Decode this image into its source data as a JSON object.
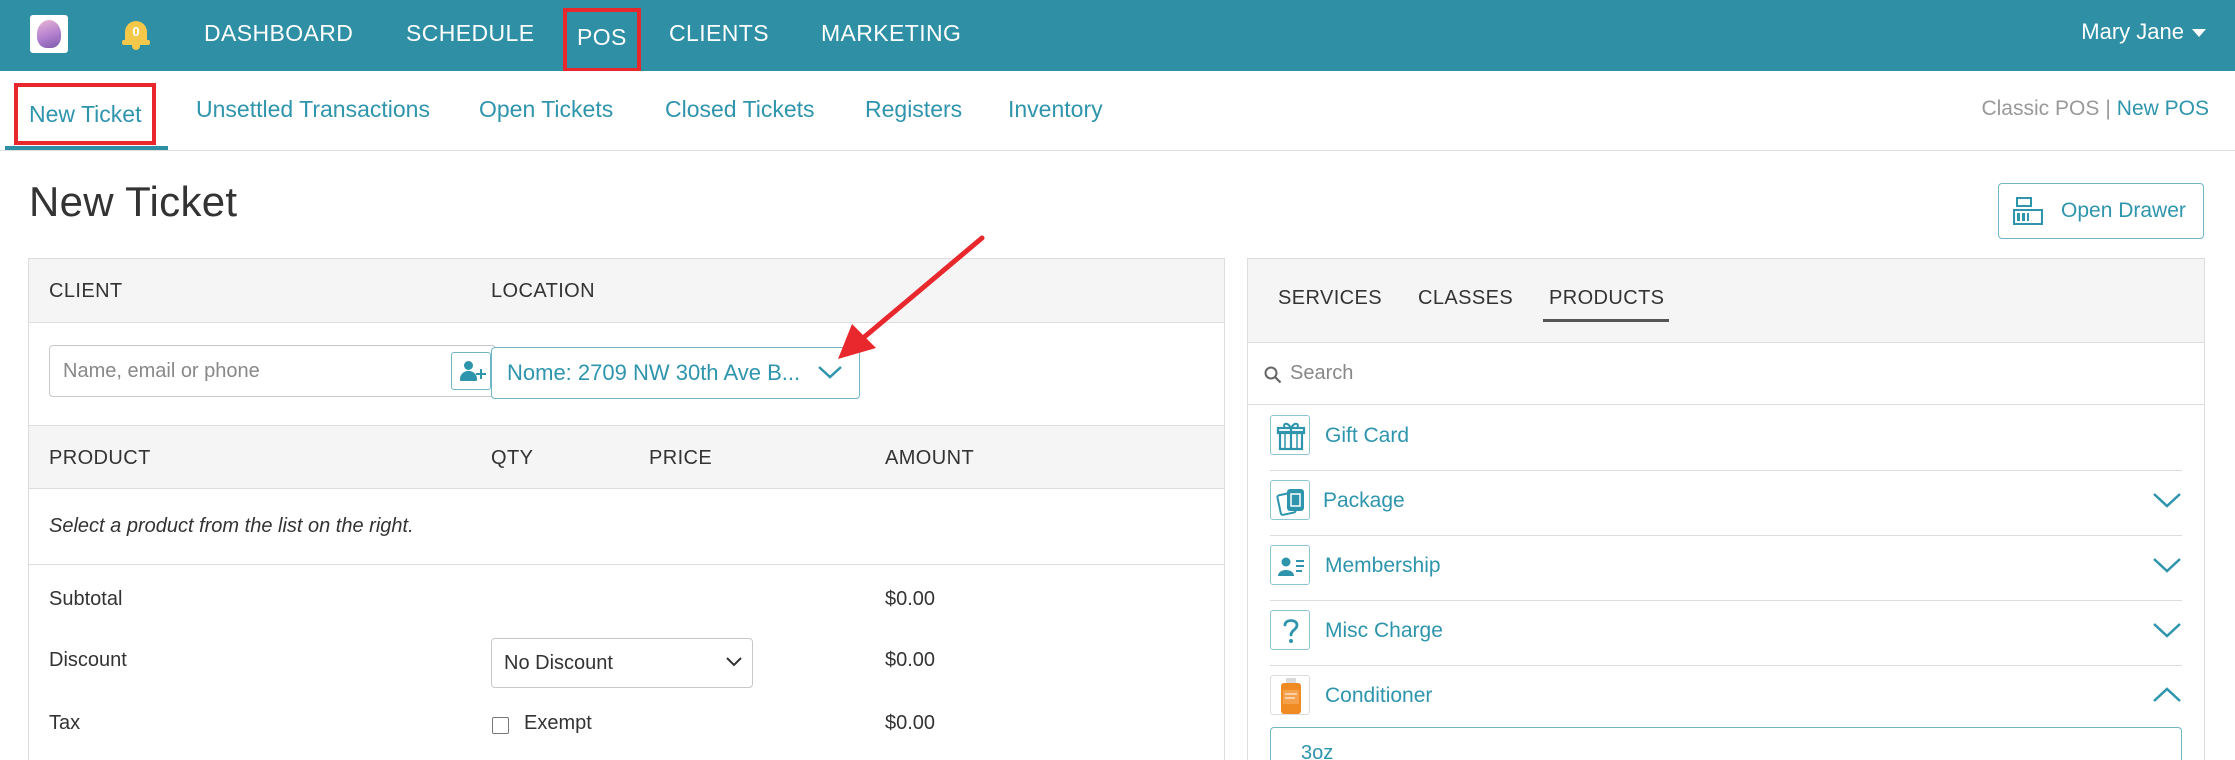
{
  "topnav": {
    "notification_count": "0",
    "items": [
      "DASHBOARD",
      "SCHEDULE",
      "POS",
      "CLIENTS",
      "MARKETING"
    ],
    "user_name": "Mary Jane"
  },
  "subnav": {
    "items": [
      "New Ticket",
      "Unsettled Transactions",
      "Open Tickets",
      "Closed Tickets",
      "Registers",
      "Inventory"
    ],
    "classic_pos": "Classic POS",
    "separator": "|",
    "new_pos": "New POS"
  },
  "page": {
    "title": "New Ticket",
    "open_drawer_label": "Open Drawer"
  },
  "ticket": {
    "client_label": "CLIENT",
    "location_label": "LOCATION",
    "client_placeholder": "Name, email or phone",
    "location_value": "Nome: 2709 NW 30th Ave B...",
    "columns": [
      "PRODUCT",
      "QTY",
      "PRICE",
      "AMOUNT"
    ],
    "empty_hint": "Select a product from the list on the right.",
    "subtotal_label": "Subtotal",
    "subtotal_value": "$0.00",
    "discount_label": "Discount",
    "discount_select": "No Discount",
    "discount_value": "$0.00",
    "tax_label": "Tax",
    "tax_exempt_label": "Exempt",
    "tax_value": "$0.00"
  },
  "catalog": {
    "tabs": [
      "SERVICES",
      "CLASSES",
      "PRODUCTS"
    ],
    "active_tab": "PRODUCTS",
    "search_placeholder": "Search",
    "items": [
      {
        "label": "Gift Card",
        "icon": "gift-icon",
        "expand": "none"
      },
      {
        "label": "Package",
        "icon": "package-icon",
        "expand": "collapsed"
      },
      {
        "label": "Membership",
        "icon": "membership-icon",
        "expand": "collapsed"
      },
      {
        "label": "Misc Charge",
        "icon": "question-icon",
        "expand": "collapsed"
      },
      {
        "label": "Conditioner",
        "icon": "conditioner-product-image",
        "expand": "expanded"
      }
    ],
    "variant": "3oz"
  },
  "colors": {
    "nav_bg": "#2e8fa5",
    "accent": "#2e95ad",
    "highlight_box": "#e8282d",
    "annotation_arrow": "#e8282d",
    "bell": "#f5c84a"
  }
}
